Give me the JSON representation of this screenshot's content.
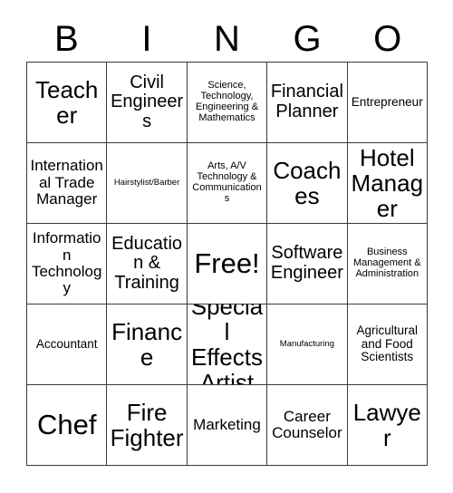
{
  "header": {
    "letters": [
      "B",
      "I",
      "N",
      "G",
      "O"
    ]
  },
  "grid": {
    "rows": 5,
    "columns": 5,
    "cells": [
      {
        "text": "Teacher",
        "size": "xl"
      },
      {
        "text": "Civil Engineers",
        "size": "lg"
      },
      {
        "text": "Science, Technology, Engineering & Mathematics",
        "size": "xs"
      },
      {
        "text": "Financial Planner",
        "size": "lg"
      },
      {
        "text": "Entrepreneur",
        "size": "sm"
      },
      {
        "text": "International Trade Manager",
        "size": "md"
      },
      {
        "text": "Hairstylist/Barber",
        "size": "xxs"
      },
      {
        "text": "Arts, A/V Technology & Communications",
        "size": "xs"
      },
      {
        "text": "Coaches",
        "size": "xl"
      },
      {
        "text": "Hotel Manager",
        "size": "xl"
      },
      {
        "text": "Information Technology",
        "size": "md"
      },
      {
        "text": "Education & Training",
        "size": "lg"
      },
      {
        "text": "Free!",
        "size": "xxl"
      },
      {
        "text": "Software Engineer",
        "size": "lg"
      },
      {
        "text": "Business Management & Administration",
        "size": "xs"
      },
      {
        "text": "Accountant",
        "size": "sm"
      },
      {
        "text": "Finance",
        "size": "xl"
      },
      {
        "text": "Special Effects Artist",
        "size": "xl"
      },
      {
        "text": "Manufacturing",
        "size": "xxs"
      },
      {
        "text": "Agricultural and Food Scientists",
        "size": "sm"
      },
      {
        "text": "Chef",
        "size": "xxl"
      },
      {
        "text": "Fire Fighter",
        "size": "xl"
      },
      {
        "text": "Marketing",
        "size": "md"
      },
      {
        "text": "Career Counselor",
        "size": "md"
      },
      {
        "text": "Lawyer",
        "size": "xl"
      }
    ]
  },
  "colors": {
    "background": "#ffffff",
    "grid_line": "#3a3a3a",
    "text": "#000000"
  }
}
